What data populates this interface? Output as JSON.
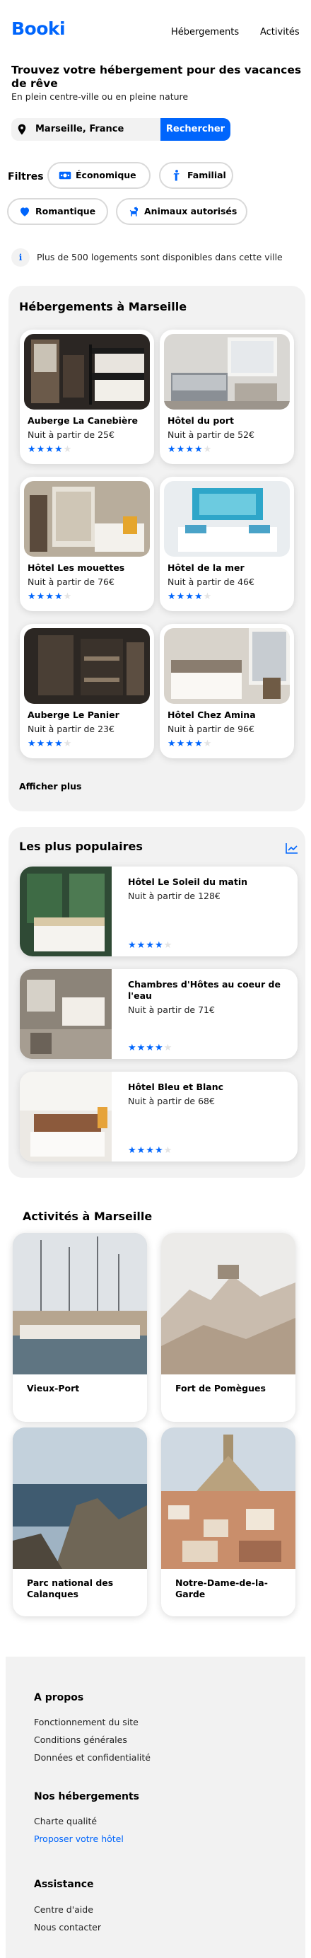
{
  "header": {
    "logo": "Booki",
    "nav": [
      "Hébergements",
      "Activités"
    ]
  },
  "hero": {
    "title": "Trouvez votre hébergement pour des vacances de rêve",
    "subtitle": "En plein centre-ville ou en pleine nature"
  },
  "search": {
    "value": "Marseille, France",
    "button": "Rechercher"
  },
  "filters": {
    "label": "Filtres",
    "items": [
      {
        "label": "Économique",
        "icon": "money-icon"
      },
      {
        "label": "Familial",
        "icon": "child-icon"
      },
      {
        "label": "Romantique",
        "icon": "heart-icon"
      },
      {
        "label": "Animaux autorisés",
        "icon": "dog-icon"
      }
    ]
  },
  "info": {
    "icon": "i",
    "text": "Plus de 500 logements sont disponibles dans cette ville"
  },
  "hebergements": {
    "title": "Hébergements à Marseille",
    "show_more": "Afficher plus",
    "items": [
      {
        "name": "Auberge La Canebière",
        "price": "Nuit à partir de 25€",
        "rating": 4
      },
      {
        "name": "Hôtel du port",
        "price": "Nuit à partir de 52€",
        "rating": 4
      },
      {
        "name": "Hôtel Les mouettes",
        "price": "Nuit à partir de 76€",
        "rating": 4
      },
      {
        "name": "Hôtel de la mer",
        "price": "Nuit à partir de 46€",
        "rating": 4
      },
      {
        "name": "Auberge Le Panier",
        "price": "Nuit à partir de 23€",
        "rating": 4
      },
      {
        "name": "Hôtel Chez Amina",
        "price": "Nuit à partir de 96€",
        "rating": 4
      }
    ]
  },
  "populaires": {
    "title": "Les plus populaires",
    "items": [
      {
        "name": "Hôtel Le Soleil du matin",
        "price": "Nuit à partir de 128€",
        "rating": 4
      },
      {
        "name": "Chambres d'Hôtes au coeur de l'eau",
        "price": "Nuit à partir de 71€",
        "rating": 4
      },
      {
        "name": "Hôtel Bleu et Blanc",
        "price": "Nuit à partir de 68€",
        "rating": 4
      }
    ]
  },
  "activites": {
    "title": "Activités à Marseille",
    "items": [
      {
        "name": "Vieux-Port"
      },
      {
        "name": "Fort de Pomègues"
      },
      {
        "name": "Parc national des Calanques"
      },
      {
        "name": "Notre-Dame-de-la-Garde"
      }
    ]
  },
  "footer": {
    "sections": [
      {
        "title": "A propos",
        "links": [
          "Fonctionnement du site",
          "Conditions générales",
          "Données et confidentialité"
        ]
      },
      {
        "title": "Nos hébergements",
        "links": [
          "Charte qualité",
          "Proposer votre hôtel"
        ]
      },
      {
        "title": "Assistance",
        "links": [
          "Centre d'aide",
          "Nous contacter"
        ]
      }
    ]
  },
  "colors": {
    "accent": "#0065FC",
    "panel": "#F2F2F2",
    "star_off": "#E3E3E3"
  }
}
